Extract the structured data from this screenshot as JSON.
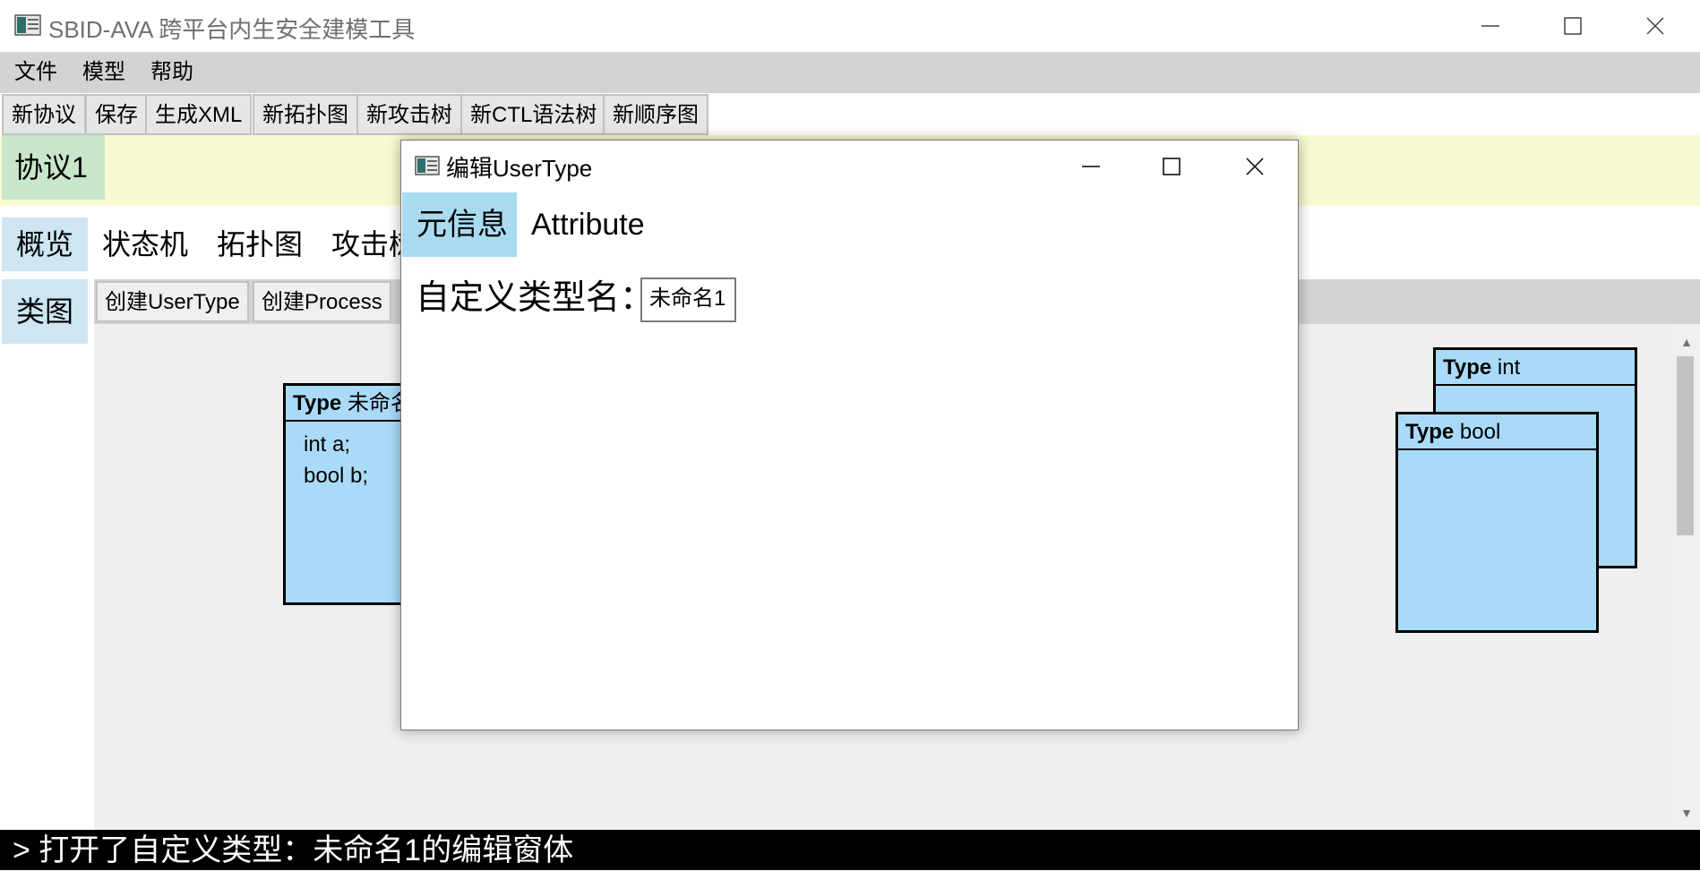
{
  "window": {
    "title": "SBID-AVA 跨平台内生安全建模工具",
    "controls": {
      "minimize": "minimize-icon",
      "maximize": "maximize-icon",
      "close": "close-icon"
    }
  },
  "menu": {
    "items": [
      "文件",
      "模型",
      "帮助"
    ]
  },
  "toolbar": {
    "buttons": [
      "新协议",
      "保存",
      "生成XML",
      "新拓扑图",
      "新攻击树",
      "新CTL语法树",
      "新顺序图"
    ]
  },
  "protocol_tab": {
    "label": "协议1"
  },
  "view_tabs": [
    "概览",
    "状态机",
    "拓扑图",
    "攻击树"
  ],
  "side_tab": {
    "label": "类图"
  },
  "sub_toolbar": {
    "buttons": [
      "创建UserType",
      "创建Process"
    ]
  },
  "canvas": {
    "types": [
      {
        "keyword": "Type",
        "name": "未命名1",
        "fields": [
          "int a;",
          "bool b;"
        ]
      },
      {
        "keyword": "Type",
        "name": "int",
        "fields": []
      },
      {
        "keyword": "Type",
        "name": "bool",
        "fields": []
      }
    ]
  },
  "status": {
    "text": "> 打开了自定义类型：未命名1的编辑窗体"
  },
  "dialog": {
    "title": "编辑UserType",
    "tabs": [
      "元信息",
      "Attribute"
    ],
    "name_label": "自定义类型名：",
    "name_value": "未命名1"
  },
  "colors": {
    "menu_bar": "#d3d3d3",
    "protocol_strip": "#fafad2",
    "protocol_tab": "#c8e6c9",
    "view_tab": "#cde6f2",
    "type_fill": "#a9dbf8",
    "status_bg": "#000000"
  }
}
